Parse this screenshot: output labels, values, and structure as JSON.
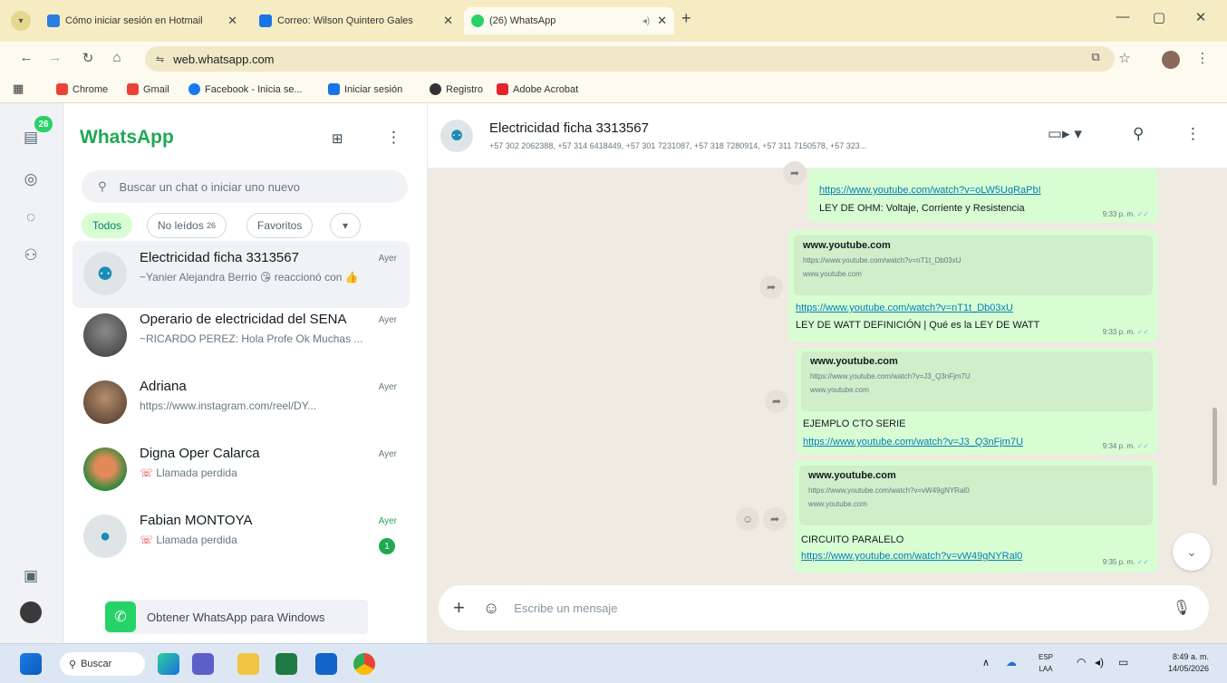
{
  "browser": {
    "tabs": [
      {
        "title": "Cómo iniciar sesión en Hotmail",
        "active": false,
        "favicon_color": "#2a7de1"
      },
      {
        "title": "Correo: Wilson Quintero Gales",
        "active": false,
        "favicon_color": "#1a73e8"
      },
      {
        "title": "(26) WhatsApp",
        "active": true,
        "favicon_color": "#25d366"
      }
    ],
    "url": "web.whatsapp.com",
    "bookmarks": [
      {
        "label": "Chrome",
        "color": "#ea4335"
      },
      {
        "label": "Gmail",
        "color": "#ea4335"
      },
      {
        "label": "Facebook - Inicia se...",
        "color": "#1877f2"
      },
      {
        "label": "Iniciar sesión",
        "color": "#1a73e8"
      },
      {
        "label": "Registro",
        "color": "#333333"
      },
      {
        "label": "Adobe Acrobat",
        "color": "#e4232b"
      }
    ]
  },
  "whatsapp": {
    "brand_color": "#1ea952",
    "rail_badge": "26",
    "title": "WhatsApp",
    "search_placeholder": "Buscar un chat o iniciar uno nuevo",
    "filters": {
      "all": "Todos",
      "unread": "No leídos",
      "unread_count": "26",
      "favorites": "Favoritos",
      "more": "▾"
    },
    "chats": [
      {
        "name": "Electricidad ficha 3313567",
        "time": "Ayer",
        "preview": "~Yanier Alejandra Berrio 😘 reaccionó con 👍",
        "selected": true
      },
      {
        "name": "Operario de electricidad del SENA",
        "time": "Ayer",
        "preview": "~RICARDO PEREZ: Hola Profe  Ok Muchas ..."
      },
      {
        "name": "Adriana",
        "time": "Ayer",
        "preview": "https://www.instagram.com/reel/DY..."
      },
      {
        "name": "Digna Oper Calarca",
        "time": "Ayer",
        "preview": "Llamada perdida"
      },
      {
        "name": "Fabian MONTOYA",
        "time": "Ayer",
        "preview": "Llamada perdida",
        "unread": "1"
      }
    ],
    "get_app": "Obtener WhatsApp para Windows"
  },
  "chat": {
    "name": "Electricidad ficha 3313567",
    "members": "+57 302 2062388, +57 314 6418449, +57 301 7231087, +57 318 7280914, +57 311 7150578, +57 323...",
    "messages": [
      {
        "link": "https://www.youtube.com/watch?v=oLW5UqRaPbI",
        "text": "LEY DE OHM: Voltaje, Corriente y Resistencia",
        "time": "9:33 p. m."
      },
      {
        "domain": "www.youtube.com",
        "url_small": "https://www.youtube.com/watch?v=nT1t_Db03xU",
        "link": "https://www.youtube.com/watch?v=nT1t_Db03xU",
        "text": "LEY DE WATT DEFINICIÓN | Qué es la LEY DE WATT",
        "time": "9:33 p. m."
      },
      {
        "domain": "www.youtube.com",
        "url_small": "https://www.youtube.com/watch?v=J3_Q3nFjm7U",
        "text": "EJEMPLO CTO SERIE",
        "link": "https://www.youtube.com/watch?v=J3_Q3nFjm7U",
        "time": "9:34 p. m."
      },
      {
        "domain": "www.youtube.com",
        "url_small": "https://www.youtube.com/watch?v=vW49gNYRal0",
        "text": "CIRCUITO PARALELO",
        "link": "https://www.youtube.com/watch?v=vW49gNYRal0",
        "time": "9:35 p. m."
      }
    ],
    "composer_placeholder": "Escribe un mensaje"
  },
  "taskbar": {
    "search": "Buscar",
    "lang": "ESP",
    "region": "LAA",
    "time": "8:49 a. m.",
    "date": "14/05/2026"
  }
}
